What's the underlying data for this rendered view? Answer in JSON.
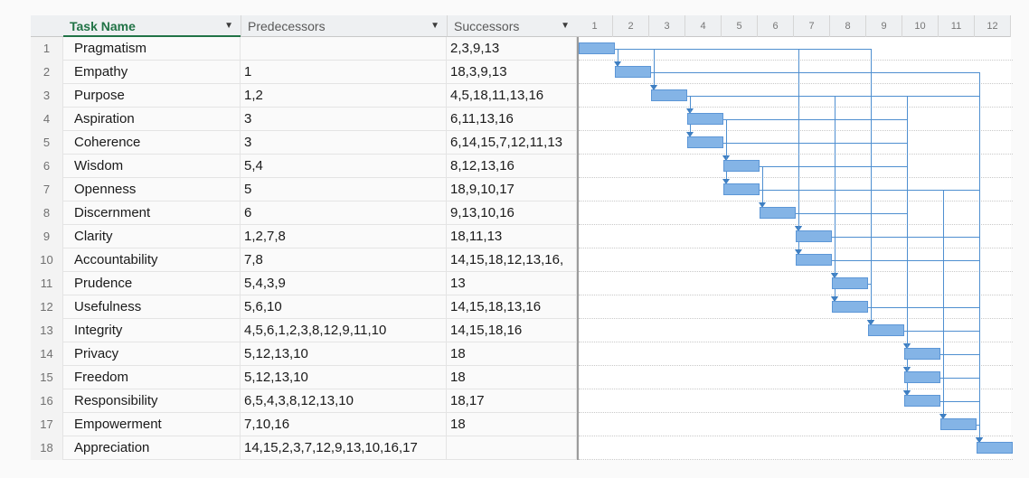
{
  "columns": {
    "task_name": "Task Name",
    "predecessors": "Predecessors",
    "successors": "Successors"
  },
  "timescale": [
    "1",
    "2",
    "3",
    "4",
    "5",
    "6",
    "7",
    "8",
    "9",
    "10",
    "11",
    "12"
  ],
  "tasks": [
    {
      "id": "1",
      "name": "Pragmatism",
      "pred": "",
      "succ": "2,3,9,13",
      "start": 0,
      "dur": 1
    },
    {
      "id": "2",
      "name": "Empathy",
      "pred": "1",
      "succ": "18,3,9,13",
      "start": 1,
      "dur": 1
    },
    {
      "id": "3",
      "name": "Purpose",
      "pred": "1,2",
      "succ": "4,5,18,11,13,16",
      "start": 2,
      "dur": 1
    },
    {
      "id": "4",
      "name": "Aspiration",
      "pred": "3",
      "succ": "6,11,13,16",
      "start": 3,
      "dur": 1
    },
    {
      "id": "5",
      "name": "Coherence",
      "pred": "3",
      "succ": "6,14,15,7,12,11,13",
      "start": 3,
      "dur": 1
    },
    {
      "id": "6",
      "name": "Wisdom",
      "pred": "5,4",
      "succ": "8,12,13,16",
      "start": 4,
      "dur": 1
    },
    {
      "id": "7",
      "name": "Openness",
      "pred": "5",
      "succ": "18,9,10,17",
      "start": 4,
      "dur": 1
    },
    {
      "id": "8",
      "name": "Discernment",
      "pred": "6",
      "succ": "9,13,10,16",
      "start": 5,
      "dur": 1
    },
    {
      "id": "9",
      "name": "Clarity",
      "pred": "1,2,7,8",
      "succ": "18,11,13",
      "start": 6,
      "dur": 1
    },
    {
      "id": "10",
      "name": "Accountability",
      "pred": "7,8",
      "succ": "14,15,18,12,13,16,",
      "start": 6,
      "dur": 1
    },
    {
      "id": "11",
      "name": "Prudence",
      "pred": "5,4,3,9",
      "succ": "13",
      "start": 7,
      "dur": 1
    },
    {
      "id": "12",
      "name": "Usefulness",
      "pred": "5,6,10",
      "succ": "14,15,18,13,16",
      "start": 7,
      "dur": 1
    },
    {
      "id": "13",
      "name": "Integrity",
      "pred": "4,5,6,1,2,3,8,12,9,11,10",
      "succ": "14,15,18,16",
      "start": 8,
      "dur": 1
    },
    {
      "id": "14",
      "name": "Privacy",
      "pred": "5,12,13,10",
      "succ": "18",
      "start": 9,
      "dur": 1
    },
    {
      "id": "15",
      "name": "Freedom",
      "pred": "5,12,13,10",
      "succ": "18",
      "start": 9,
      "dur": 1
    },
    {
      "id": "16",
      "name": "Responsibility",
      "pred": "6,5,4,3,8,12,13,10",
      "succ": "18,17",
      "start": 9,
      "dur": 1
    },
    {
      "id": "17",
      "name": "Empowerment",
      "pred": "7,10,16",
      "succ": "18",
      "start": 10,
      "dur": 1
    },
    {
      "id": "18",
      "name": "Appreciation",
      "pred": "14,15,2,3,7,12,9,13,10,16,17",
      "succ": "",
      "start": 11,
      "dur": 1
    }
  ],
  "colors": {
    "bar": "#84b4e6",
    "bar_border": "#5c96d6",
    "link": "#4f8fd0",
    "header_accent": "#217346"
  }
}
